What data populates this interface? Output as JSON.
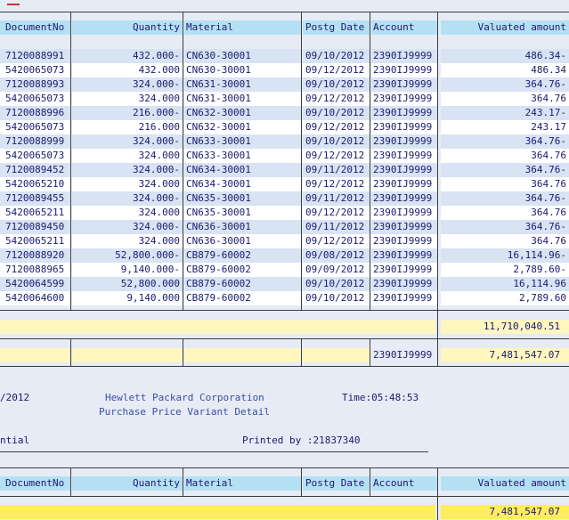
{
  "columns": {
    "doc_no": "DocumentNo",
    "quantity": "Quantity",
    "material": "Material",
    "postg_date": "Postg Date",
    "account": "Account",
    "valuated_amount": "Valuated amount"
  },
  "rows": [
    {
      "doc": "7120088991",
      "qty": "432.000-",
      "mat": "CN630-30001",
      "date": "09/10/2012",
      "acct": "2390IJ9999",
      "amt": "486.34-"
    },
    {
      "doc": "5420065073",
      "qty": "432.000",
      "mat": "CN630-30001",
      "date": "09/12/2012",
      "acct": "2390IJ9999",
      "amt": "486.34"
    },
    {
      "doc": "7120088993",
      "qty": "324.000-",
      "mat": "CN631-30001",
      "date": "09/10/2012",
      "acct": "2390IJ9999",
      "amt": "364.76-"
    },
    {
      "doc": "5420065073",
      "qty": "324.000",
      "mat": "CN631-30001",
      "date": "09/12/2012",
      "acct": "2390IJ9999",
      "amt": "364.76"
    },
    {
      "doc": "7120088996",
      "qty": "216.000-",
      "mat": "CN632-30001",
      "date": "09/10/2012",
      "acct": "2390IJ9999",
      "amt": "243.17-"
    },
    {
      "doc": "5420065073",
      "qty": "216.000",
      "mat": "CN632-30001",
      "date": "09/12/2012",
      "acct": "2390IJ9999",
      "amt": "243.17"
    },
    {
      "doc": "7120088999",
      "qty": "324.000-",
      "mat": "CN633-30001",
      "date": "09/10/2012",
      "acct": "2390IJ9999",
      "amt": "364.76-"
    },
    {
      "doc": "5420065073",
      "qty": "324.000",
      "mat": "CN633-30001",
      "date": "09/12/2012",
      "acct": "2390IJ9999",
      "amt": "364.76"
    },
    {
      "doc": "7120089452",
      "qty": "324.000-",
      "mat": "CN634-30001",
      "date": "09/11/2012",
      "acct": "2390IJ9999",
      "amt": "364.76-"
    },
    {
      "doc": "5420065210",
      "qty": "324.000",
      "mat": "CN634-30001",
      "date": "09/12/2012",
      "acct": "2390IJ9999",
      "amt": "364.76"
    },
    {
      "doc": "7120089455",
      "qty": "324.000-",
      "mat": "CN635-30001",
      "date": "09/11/2012",
      "acct": "2390IJ9999",
      "amt": "364.76-"
    },
    {
      "doc": "5420065211",
      "qty": "324.000",
      "mat": "CN635-30001",
      "date": "09/12/2012",
      "acct": "2390IJ9999",
      "amt": "364.76"
    },
    {
      "doc": "7120089450",
      "qty": "324.000-",
      "mat": "CN636-30001",
      "date": "09/11/2012",
      "acct": "2390IJ9999",
      "amt": "364.76-"
    },
    {
      "doc": "5420065211",
      "qty": "324.000",
      "mat": "CN636-30001",
      "date": "09/12/2012",
      "acct": "2390IJ9999",
      "amt": "364.76"
    },
    {
      "doc": "7120088920",
      "qty": "52,800.000-",
      "mat": "CB879-60002",
      "date": "09/08/2012",
      "acct": "2390IJ9999",
      "amt": "16,114.96-"
    },
    {
      "doc": "7120088965",
      "qty": "9,140.000-",
      "mat": "CB879-60002",
      "date": "09/09/2012",
      "acct": "2390IJ9999",
      "amt": "2,789.60-"
    },
    {
      "doc": "5420064599",
      "qty": "52,800.000",
      "mat": "CB879-60002",
      "date": "09/10/2012",
      "acct": "2390IJ9999",
      "amt": "16,114.96"
    },
    {
      "doc": "5420064600",
      "qty": "9,140.000",
      "mat": "CB879-60002",
      "date": "09/10/2012",
      "acct": "2390IJ9999",
      "amt": "2,789.60"
    }
  ],
  "totals": {
    "grand_total": "11,710,040.51",
    "account_subtotal_account": "2390IJ9999",
    "account_subtotal": "7,481,547.07",
    "bottom_total": "7,481,547.07"
  },
  "page_header": {
    "date_fragment": "/2012",
    "company": "Hewlett Packard Corporation",
    "time": "Time:05:48:53",
    "report_title": "Purchase Price Variant Detail",
    "left_fragment": "ntial",
    "printed_by": "Printed by :21837340"
  },
  "colors": {
    "background": "#e6ebf5",
    "header_cell": "#b5e0f4",
    "row_stripe": "#d8e3f3",
    "row_plain": "#ffffff",
    "subtotal": "#fff6c0",
    "total_highlight": "#ffee5c",
    "text": "#1a1a6e",
    "company_text": "#3b4fa0"
  }
}
